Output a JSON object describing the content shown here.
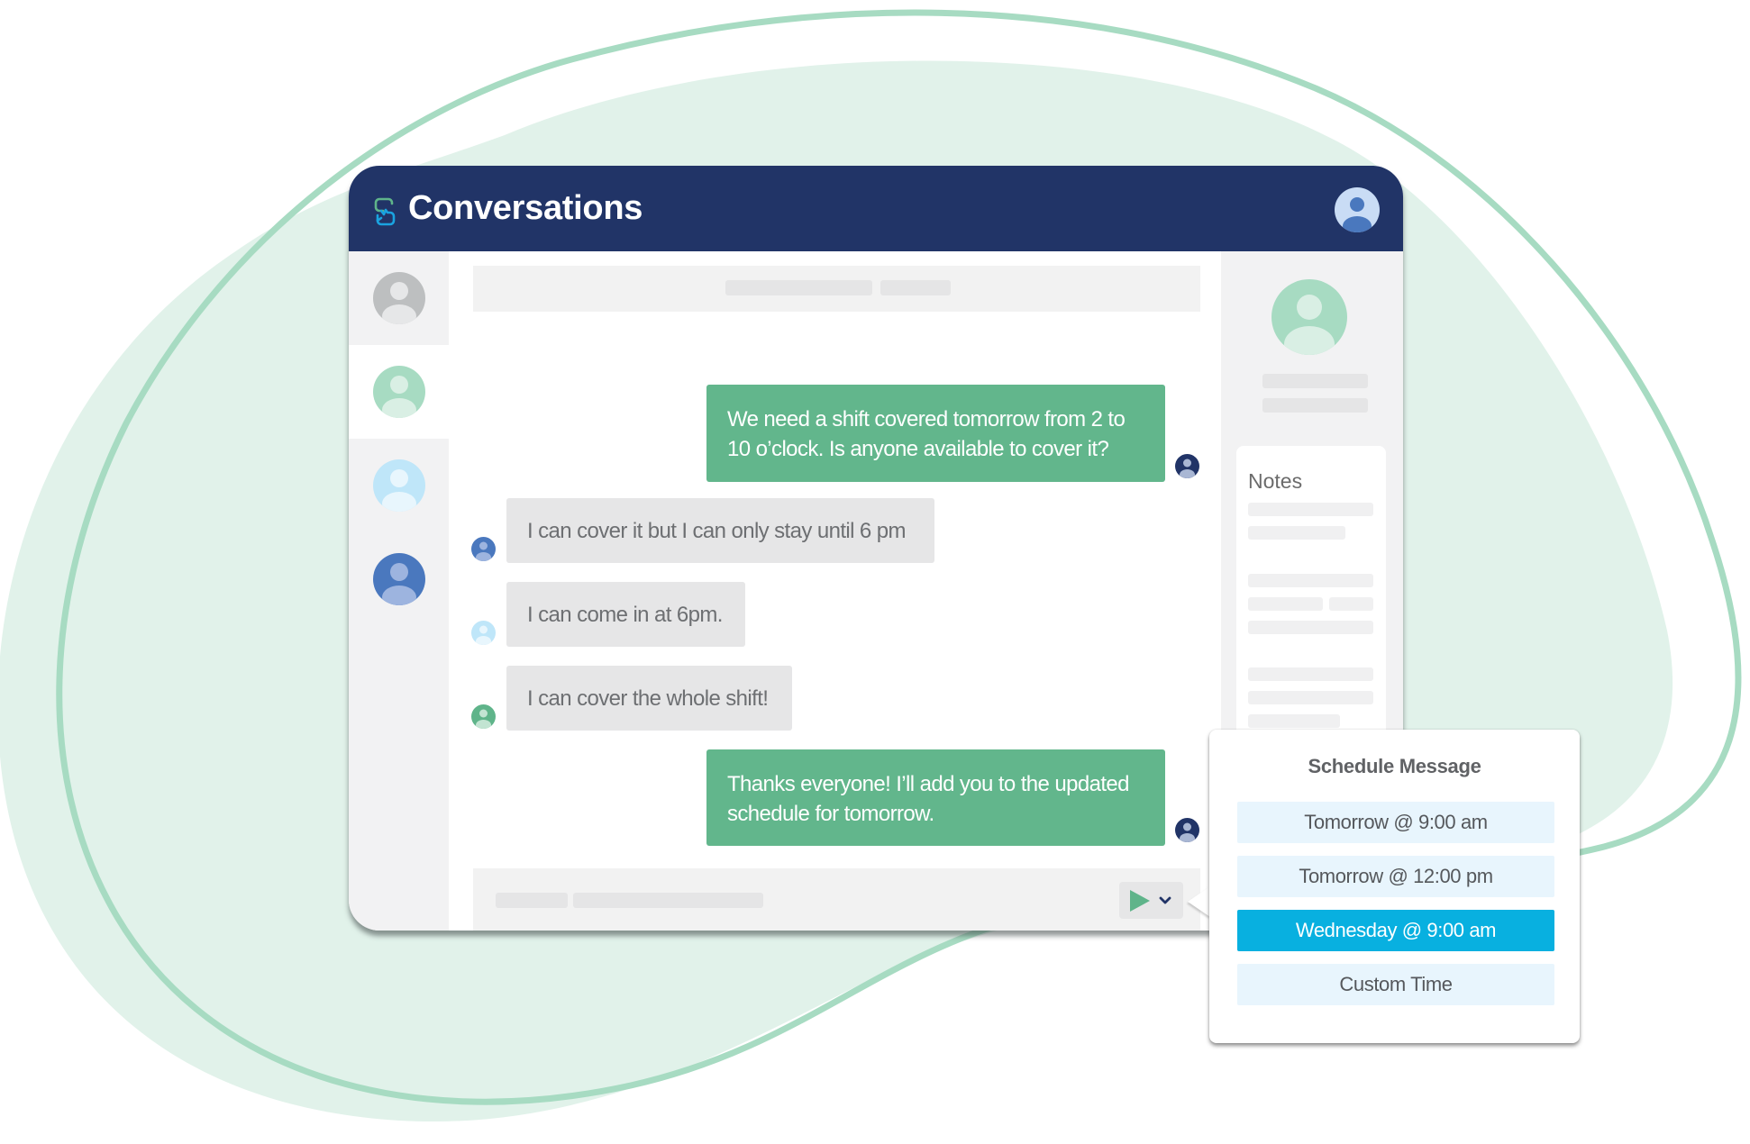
{
  "colors": {
    "header_bg": "#213467",
    "outgoing_bubble": "#62b68c",
    "incoming_bubble": "#e6e6e7",
    "selected_option": "#08b0e0",
    "option_bg": "#e8f5fd",
    "blob_fill": "#e1f2ea",
    "blob_outline": "#a7dbc2"
  },
  "header": {
    "logo_icon": "chat-logo-icon",
    "title": "Conversations",
    "user_avatar_icon": "user-avatar-icon"
  },
  "sidebar": {
    "items": [
      {
        "name": "contact-gray",
        "color": "#bdbfc0",
        "active": false
      },
      {
        "name": "contact-green",
        "color": "#a7dbc2",
        "active": true
      },
      {
        "name": "contact-lightblue",
        "color": "#bfe6f9",
        "active": false
      },
      {
        "name": "contact-blue",
        "color": "#4a78be",
        "active": false
      }
    ]
  },
  "messages": [
    {
      "direction": "outgoing",
      "text_lines": [
        "We need a shift covered tomorrow from 2 to",
        "10 o’clock. Is anyone available to cover it?"
      ]
    },
    {
      "direction": "incoming",
      "text": "I can cover it but I can only stay until 6 pm",
      "avatar_color": "#4a78be"
    },
    {
      "direction": "incoming",
      "text": "I can come in at 6pm.",
      "avatar_color": "#bfe6f9"
    },
    {
      "direction": "incoming",
      "text": "I can cover the whole shift!",
      "avatar_color": "#5fb48a"
    },
    {
      "direction": "outgoing",
      "text_lines": [
        "Thanks everyone! I’ll add you to the updated",
        "schedule for tomorrow."
      ]
    }
  ],
  "composer": {
    "send_icon": "send-icon",
    "dropdown_icon": "chevron-down-icon"
  },
  "right_panel": {
    "notes_title": "Notes"
  },
  "schedule_popup": {
    "title": "Schedule Message",
    "options": [
      {
        "label": "Tomorrow @ 9:00 am",
        "selected": false
      },
      {
        "label": "Tomorrow @ 12:00 pm",
        "selected": false
      },
      {
        "label": "Wednesday @ 9:00 am",
        "selected": true
      },
      {
        "label": "Custom Time",
        "selected": false
      }
    ]
  }
}
